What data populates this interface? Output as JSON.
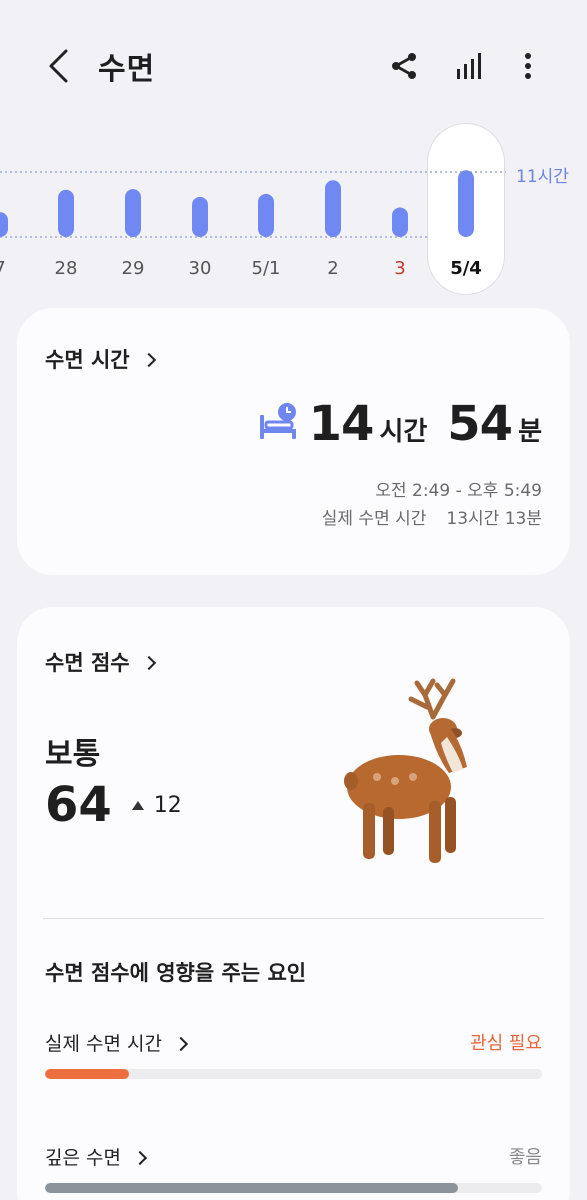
{
  "header": {
    "title": "수면",
    "icons": [
      "back-icon",
      "share-icon",
      "stats-icon",
      "more-icon"
    ]
  },
  "chart_data": {
    "type": "bar",
    "categories": [
      "7",
      "28",
      "29",
      "30",
      "5/1",
      "2",
      "3",
      "5/4"
    ],
    "values": [
      4.2,
      8.0,
      8.1,
      6.8,
      7.3,
      9.6,
      5.0,
      11.3
    ],
    "reference_line_label": "11시간",
    "reference_line_value": 11,
    "baseline_dotted": true,
    "selected": "5/4",
    "highlighted_red": "3",
    "bar_color": "#7088f2"
  },
  "sleep_time": {
    "heading": "수면 시간",
    "hours": "14",
    "hours_unit": "시간",
    "minutes": "54",
    "minutes_unit": "분",
    "range": "오전 2:49 - 오후 5:49",
    "actual_label": "실제 수면 시간",
    "actual_value": "13시간 13분"
  },
  "sleep_score": {
    "heading": "수면 점수",
    "grade": "보통",
    "score": "64",
    "delta": "12",
    "factors_title": "수면 점수에 영향을 주는 요인",
    "factors": [
      {
        "label": "실제 수면 시간",
        "status": "관심 필요",
        "level": 0.17
      },
      {
        "label": "깊은 수면",
        "status": "좋음",
        "level": 0.83
      }
    ]
  },
  "colors": {
    "accent": "#7088f2",
    "warn": "#ed6e3f",
    "good_bar": "#8c939a"
  }
}
